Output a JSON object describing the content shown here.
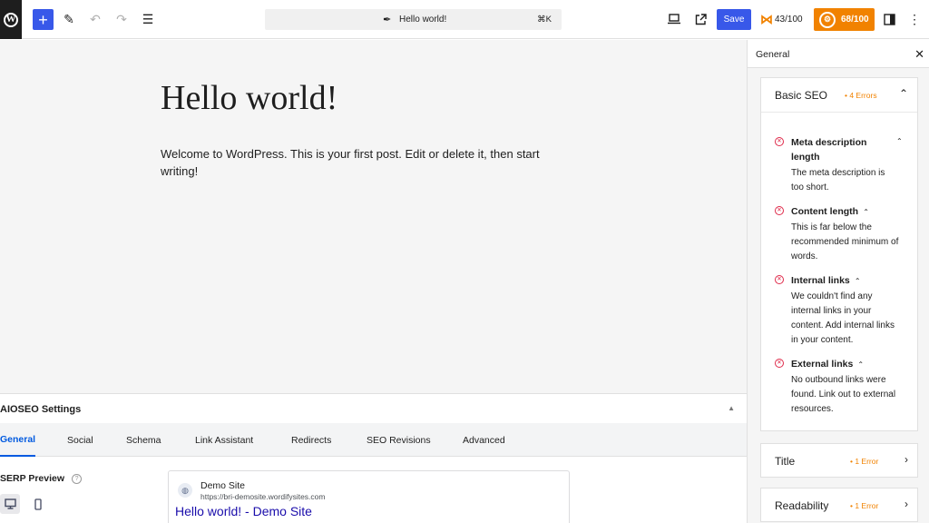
{
  "toolbar": {
    "logo_letter": "W",
    "add_symbol": "+",
    "command_title": "Hello world!",
    "command_shortcut": "⌘K",
    "save_label": "Save",
    "content_score": "43/100",
    "seo_score": "68/100"
  },
  "post": {
    "title": "Hello world!",
    "content": "Welcome to WordPress. This is your first post. Edit or delete it, then start writing!"
  },
  "aioseo": {
    "header": "AIOSEO Settings",
    "tabs": [
      {
        "label": "General",
        "active": true
      },
      {
        "label": "Social"
      },
      {
        "label": "Schema"
      },
      {
        "label": "Link Assistant"
      },
      {
        "label": "Redirects"
      },
      {
        "label": "SEO Revisions"
      },
      {
        "label": "Advanced"
      }
    ],
    "serp_label": "SERP Preview",
    "serp": {
      "site_name": "Demo Site",
      "url": "https://bri-demosite.wordifysites.com",
      "title": "Hello world! - Demo Site"
    }
  },
  "sidebar": {
    "header": "General",
    "basic_seo": {
      "title": "Basic SEO",
      "badge": "• 4 Errors",
      "issues": [
        {
          "title_line1": "Meta description",
          "title_line2": "length",
          "desc": [
            "The meta description is",
            "too short."
          ]
        },
        {
          "title_line1": "Content length",
          "desc": [
            "This is far below the",
            "recommended minimum of",
            "words."
          ]
        },
        {
          "title_line1": "Internal links",
          "desc": [
            "We couldn't find any",
            "internal links in your",
            "content. Add internal links",
            "in your content."
          ]
        },
        {
          "title_line1": "External links",
          "desc": [
            "No outbound links were",
            "found. Link out to external",
            "resources."
          ]
        }
      ]
    },
    "title_card": {
      "title": "Title",
      "badge": "• 1 Error"
    },
    "readability_card": {
      "title": "Readability",
      "badge": "• 1 Error"
    }
  },
  "colors": {
    "accent": "#3858e9",
    "aioseo_orange": "#f18200",
    "error_red": "#df2a4a",
    "serp_link": "#1a0dab"
  },
  "icons": {
    "logo": "wordpress-logo-icon",
    "pen": "pen-icon",
    "undo": "undo-icon",
    "redo": "redo-icon",
    "list_view": "list-view-icon",
    "feather": "feather-icon",
    "preview": "laptop-icon",
    "external": "external-link-icon",
    "sidebar_toggle": "sidebar-toggle-icon",
    "more": "more-vertical-icon"
  }
}
